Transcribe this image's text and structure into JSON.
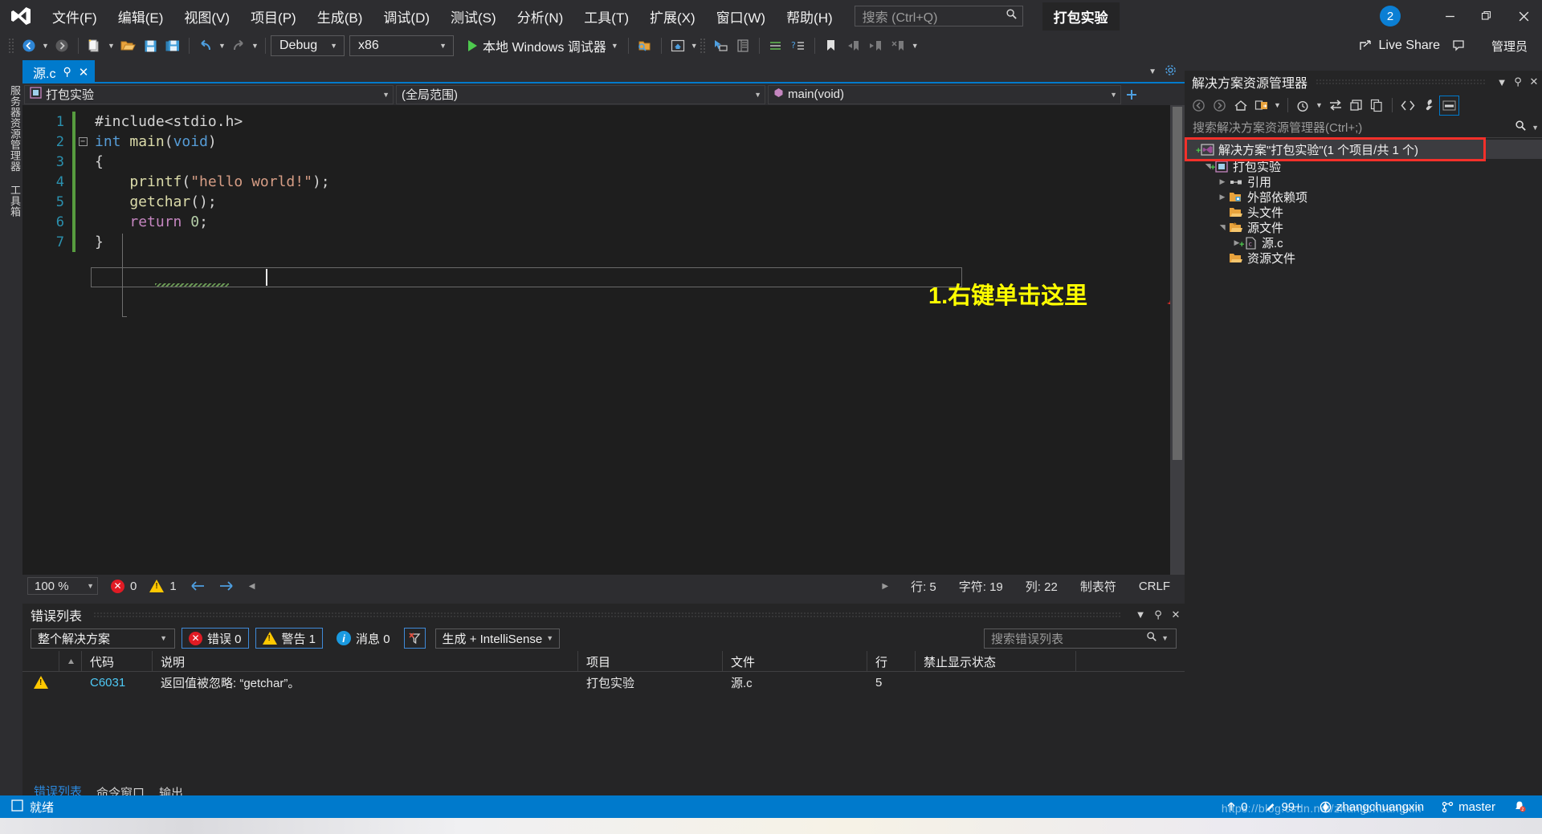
{
  "app": {
    "logo": "vs-logo",
    "pkg_title": "打包实验",
    "notification_count": "2"
  },
  "menubar": {
    "items": [
      {
        "label": "文件(F)",
        "key": "F"
      },
      {
        "label": "编辑(E)",
        "key": "E"
      },
      {
        "label": "视图(V)",
        "key": "V"
      },
      {
        "label": "项目(P)",
        "key": "P"
      },
      {
        "label": "生成(B)",
        "key": "B"
      },
      {
        "label": "调试(D)",
        "key": "D"
      },
      {
        "label": "测试(S)",
        "key": "S"
      },
      {
        "label": "分析(N)",
        "key": "N"
      },
      {
        "label": "工具(T)",
        "key": "T"
      },
      {
        "label": "扩展(X)",
        "key": "X"
      },
      {
        "label": "窗口(W)",
        "key": "W"
      },
      {
        "label": "帮助(H)",
        "key": "H"
      }
    ]
  },
  "search": {
    "placeholder": "搜索 (Ctrl+Q)",
    "icon": "search-icon"
  },
  "window_controls": {
    "minimize": "—",
    "restore": "❐",
    "close": "✕"
  },
  "toolbar": {
    "config": "Debug",
    "platform": "x86",
    "run_label": "本地 Windows 调试器",
    "live_share": "Live Share",
    "admin": "管理员"
  },
  "leftbar": {
    "tabs": [
      "服务器资源管理器",
      "工具箱"
    ]
  },
  "editor": {
    "tab_name": "源.c",
    "nav_project": "打包实验",
    "nav_scope": "(全局范围)",
    "nav_member": "main(void)",
    "lines": [
      {
        "num": "1",
        "tokens": [
          {
            "t": "#include",
            "c": "k-gray"
          },
          {
            "t": "<",
            "c": "k-gray"
          },
          {
            "t": "stdio.h",
            "c": "k-gray"
          },
          {
            "t": ">",
            "c": "k-gray"
          }
        ]
      },
      {
        "num": "2",
        "tokens": [
          {
            "t": "int",
            "c": "k-blue"
          },
          {
            "t": " ",
            "c": "k-gray"
          },
          {
            "t": "main",
            "c": "k-fn"
          },
          {
            "t": "(",
            "c": "k-gray"
          },
          {
            "t": "void",
            "c": "k-blue"
          },
          {
            "t": ")",
            "c": "k-gray"
          }
        ]
      },
      {
        "num": "3",
        "tokens": [
          {
            "t": "{",
            "c": "k-gray"
          }
        ]
      },
      {
        "num": "4",
        "tokens": [
          {
            "t": "    printf",
            "c": "k-fn"
          },
          {
            "t": "(",
            "c": "k-gray"
          },
          {
            "t": "\"hello world!\"",
            "c": "k-str"
          },
          {
            "t": ");",
            "c": "k-gray"
          }
        ]
      },
      {
        "num": "5",
        "tokens": [
          {
            "t": "    getchar",
            "c": "k-fn"
          },
          {
            "t": "();",
            "c": "k-gray"
          }
        ]
      },
      {
        "num": "6",
        "tokens": [
          {
            "t": "    ",
            "c": "k-gray"
          },
          {
            "t": "return",
            "c": "k-purple"
          },
          {
            "t": " ",
            "c": "k-gray"
          },
          {
            "t": "0",
            "c": "k-num"
          },
          {
            "t": ";",
            "c": "k-gray"
          }
        ]
      },
      {
        "num": "7",
        "tokens": [
          {
            "t": "}",
            "c": "k-gray"
          }
        ]
      }
    ],
    "status": {
      "zoom": "100 %",
      "errors": "0",
      "warnings": "1",
      "line": "行: 5",
      "char": "字符: 19",
      "col": "列: 22",
      "tabmode": "制表符",
      "eol": "CRLF"
    }
  },
  "annotation": {
    "text": "1.右键单击这里",
    "color": "#ffff00",
    "arrow_color": "#f4302a"
  },
  "error_list": {
    "title": "错误列表",
    "scope_filter": "整个解决方案",
    "errors_label": "错误 0",
    "warnings_label": "警告 1",
    "messages_label": "消息 0",
    "build_filter": "生成 + IntelliSense",
    "search_placeholder": "搜索错误列表",
    "columns": [
      "",
      "",
      "代码",
      "说明",
      "项目",
      "文件",
      "行",
      "禁止显示状态"
    ],
    "rows": [
      {
        "severity": "warning",
        "code": "C6031",
        "description": "返回值被忽略: “getchar”。",
        "project": "打包实验",
        "file": "源.c",
        "line": "5",
        "suppression": ""
      }
    ],
    "footer_tabs": [
      "错误列表",
      "命令窗口",
      "输出"
    ],
    "footer_active": "错误列表"
  },
  "solution_explorer": {
    "title": "解决方案资源管理器",
    "search_placeholder": "搜索解决方案资源管理器(Ctrl+;)",
    "tree": [
      {
        "depth": 0,
        "label": "解决方案\"打包实验\"(1 个项目/共 1 个)",
        "icon": "solution-icon",
        "twisty": "",
        "highlighted": true,
        "plus": true
      },
      {
        "depth": 1,
        "label": "打包实验",
        "icon": "project-icon",
        "twisty": "▲",
        "plus": true
      },
      {
        "depth": 2,
        "label": "引用",
        "icon": "references-icon",
        "twisty": "▶"
      },
      {
        "depth": 2,
        "label": "外部依赖项",
        "icon": "external-deps-icon",
        "twisty": "▶"
      },
      {
        "depth": 2,
        "label": "头文件",
        "icon": "folder-icon",
        "twisty": ""
      },
      {
        "depth": 2,
        "label": "源文件",
        "icon": "folder-open-icon",
        "twisty": "▲"
      },
      {
        "depth": 3,
        "label": "源.c",
        "icon": "c-file-icon",
        "twisty": "▶",
        "plus": true
      },
      {
        "depth": 2,
        "label": "资源文件",
        "icon": "folder-icon",
        "twisty": ""
      }
    ]
  },
  "statusbar": {
    "ready": "就绪",
    "up_count": "0",
    "pen_count": "99+",
    "repo": "zhangchuangxin",
    "branch": "master"
  },
  "watermark": "https://blog.csdn.net/zhangchuangxin"
}
